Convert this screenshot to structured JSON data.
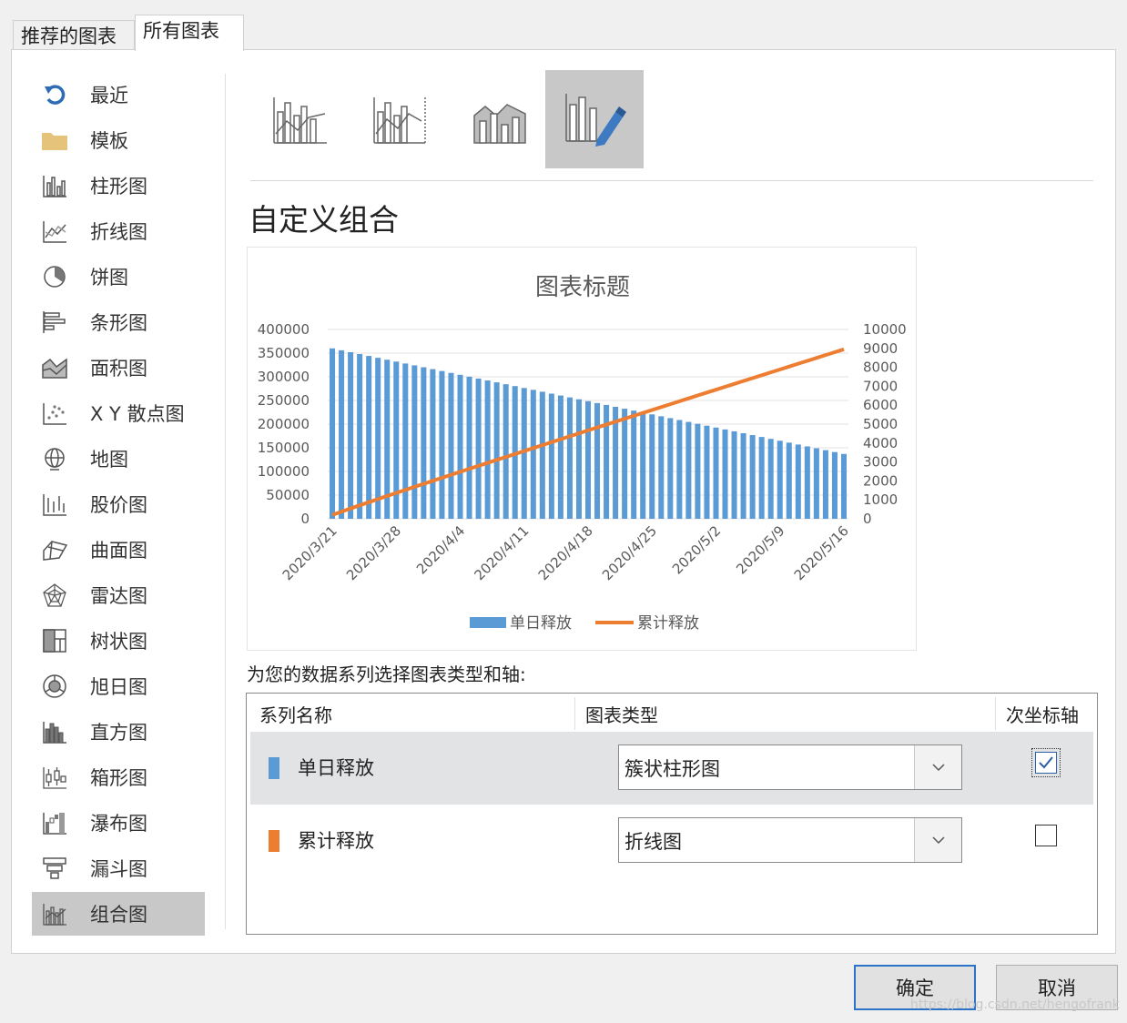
{
  "tabs": [
    "推荐的图表",
    "所有图表"
  ],
  "sidebar": {
    "items": [
      {
        "label": "最近",
        "icon": "undo-icon"
      },
      {
        "label": "模板",
        "icon": "folder-icon"
      },
      {
        "label": "柱形图",
        "icon": "column-chart-icon"
      },
      {
        "label": "折线图",
        "icon": "line-chart-icon"
      },
      {
        "label": "饼图",
        "icon": "pie-chart-icon"
      },
      {
        "label": "条形图",
        "icon": "bar-chart-icon"
      },
      {
        "label": "面积图",
        "icon": "area-chart-icon"
      },
      {
        "label": "X Y 散点图",
        "icon": "scatter-chart-icon"
      },
      {
        "label": "地图",
        "icon": "map-chart-icon"
      },
      {
        "label": "股价图",
        "icon": "stock-chart-icon"
      },
      {
        "label": "曲面图",
        "icon": "surface-chart-icon"
      },
      {
        "label": "雷达图",
        "icon": "radar-chart-icon"
      },
      {
        "label": "树状图",
        "icon": "treemap-chart-icon"
      },
      {
        "label": "旭日图",
        "icon": "sunburst-chart-icon"
      },
      {
        "label": "直方图",
        "icon": "histogram-chart-icon"
      },
      {
        "label": "箱形图",
        "icon": "boxwhisker-chart-icon"
      },
      {
        "label": "瀑布图",
        "icon": "waterfall-chart-icon"
      },
      {
        "label": "漏斗图",
        "icon": "funnel-chart-icon"
      },
      {
        "label": "组合图",
        "icon": "combo-chart-icon"
      }
    ],
    "selected": 18
  },
  "subtypes": [
    "clustered-column-line-icon",
    "clustered-column-line-secondary-icon",
    "stacked-area-column-icon",
    "custom-combination-icon"
  ],
  "subtype_title": "自定义组合",
  "chart_data": {
    "type": "bar",
    "title": "图表标题",
    "x_start": "2020/3/21",
    "x_end": "2020/5/16",
    "x_tick_labels": [
      "2020/3/21",
      "2020/3/28",
      "2020/4/4",
      "2020/4/11",
      "2020/4/18",
      "2020/4/25",
      "2020/5/2",
      "2020/5/9",
      "2020/5/16"
    ],
    "y_left_ticks": [
      "400000",
      "350000",
      "300000",
      "250000",
      "200000",
      "150000",
      "100000",
      "50000",
      "0"
    ],
    "y_right_ticks": [
      "10000",
      "9000",
      "8000",
      "7000",
      "6000",
      "5000",
      "4000",
      "3000",
      "2000",
      "1000",
      "0"
    ],
    "ylim_left": [
      0,
      400000
    ],
    "ylim_right": [
      0,
      10000
    ],
    "series": [
      {
        "name": "单日释放",
        "type": "bar",
        "axis": "primary",
        "color": "#5b9bd5",
        "start": 360000,
        "end": 137000
      },
      {
        "name": "累计释放",
        "type": "line",
        "axis": "secondary",
        "color": "#ed7d31",
        "start": 200,
        "end": 8950
      }
    ],
    "legend": "bottom"
  },
  "prompt": "为您的数据系列选择图表类型和轴:",
  "table": {
    "headers": [
      "系列名称",
      "图表类型",
      "次坐标轴"
    ],
    "rows": [
      {
        "name": "单日释放",
        "color": "#5b9bd5",
        "chart_type": "簇状柱形图",
        "secondary": true
      },
      {
        "name": "累计释放",
        "color": "#ed7d31",
        "chart_type": "折线图",
        "secondary": false
      }
    ]
  },
  "buttons": {
    "ok": "确定",
    "cancel": "取消"
  },
  "watermark": "https://blog.csdn.net/hengofrank"
}
